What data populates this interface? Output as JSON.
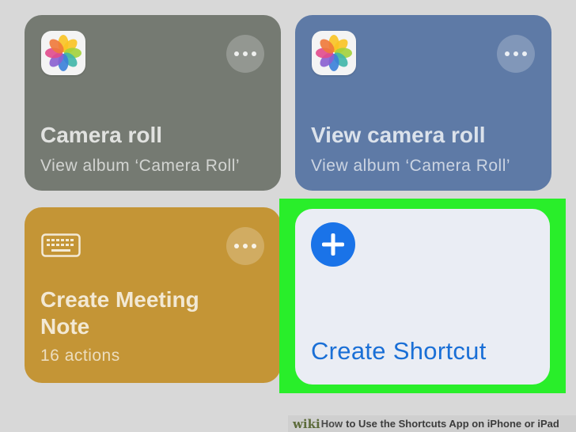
{
  "cards": [
    {
      "id": "camera-roll",
      "title": "Camera roll",
      "subtitle": "View album ‘Camera Roll’",
      "icon": "photos-icon",
      "color": "#757a72"
    },
    {
      "id": "view-camera-roll",
      "title": "View camera roll",
      "subtitle": "View album ‘Camera Roll’",
      "icon": "photos-icon",
      "color": "#5e7aa6"
    },
    {
      "id": "create-meeting-note",
      "title": "Create Meeting Note",
      "subtitle": "16 actions",
      "icon": "keyboard-icon",
      "color": "#c49536"
    }
  ],
  "create": {
    "label": "Create Shortcut",
    "icon": "plus-icon",
    "accent": "#1a73e8",
    "highlight_color": "#29ee2a"
  },
  "watermark": {
    "brand": "wiki",
    "how": "How",
    "text": "to Use the Shortcuts App on iPhone or iPad"
  }
}
